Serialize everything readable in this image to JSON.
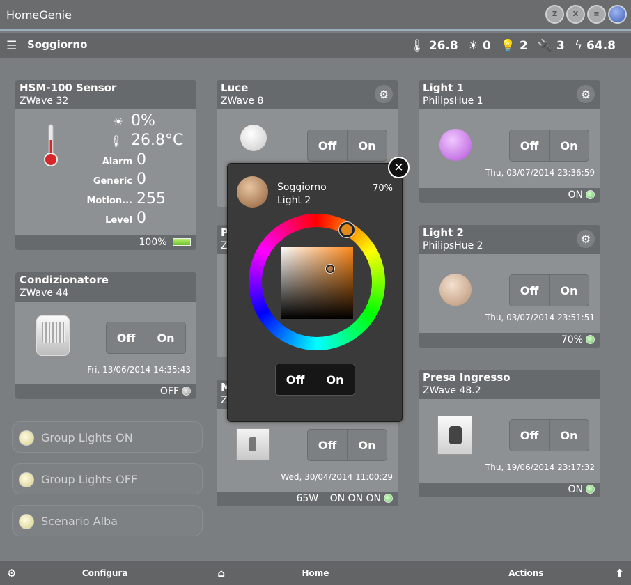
{
  "app": {
    "title": "HomeGenie"
  },
  "header": {
    "room": "Soggiorno",
    "stats": [
      {
        "icon": "thermometer-icon",
        "value": "26.8"
      },
      {
        "icon": "sun-icon",
        "value": "0"
      },
      {
        "icon": "bulb-icon",
        "value": "2"
      },
      {
        "icon": "plug-icon",
        "value": "3"
      },
      {
        "icon": "lightning-icon",
        "value": "64.8"
      }
    ]
  },
  "cards": {
    "hsm": {
      "title": "HSM-100 Sensor",
      "subtitle": "ZWave 32",
      "luminance": "0%",
      "temperature": "26.8°C",
      "rows": [
        {
          "label": "Alarm",
          "value": "0"
        },
        {
          "label": "Generic",
          "value": "0"
        },
        {
          "label": "Motion...",
          "value": "255"
        },
        {
          "label": "Level",
          "value": "0"
        }
      ],
      "battery": "100%"
    },
    "condizionatore": {
      "title": "Condizionatore",
      "subtitle": "ZWave 44",
      "off": "Off",
      "on": "On",
      "timestamp": "Fri, 13/06/2014 14:35:43",
      "status": "OFF"
    },
    "luce": {
      "title": "Luce",
      "subtitle": "ZWave 8",
      "off": "Off",
      "on": "On"
    },
    "partial1": {
      "title": "P",
      "subtitle": "Z"
    },
    "partial2": {
      "title": "M",
      "subtitle": "Z",
      "off": "Off",
      "on": "On",
      "timestamp": "Wed, 30/04/2014 11:00:29",
      "power": "65W",
      "status": "ON ON ON"
    },
    "light1": {
      "title": "Light 1",
      "subtitle": "PhilipsHue 1",
      "off": "Off",
      "on": "On",
      "timestamp": "Thu, 03/07/2014 23:36:59",
      "status": "ON",
      "color": "#c77be6"
    },
    "light2": {
      "title": "Light 2",
      "subtitle": "PhilipsHue 2",
      "off": "Off",
      "on": "On",
      "timestamp": "Thu, 03/07/2014 23:51:51",
      "status": "70%",
      "color": "#c9a98c"
    },
    "presa": {
      "title": "Presa Ingresso",
      "subtitle": "ZWave 48.2",
      "off": "Off",
      "on": "On",
      "timestamp": "Thu, 19/06/2014 23:17:32",
      "status": "ON"
    }
  },
  "scenarios": [
    {
      "label": "Group Lights ON"
    },
    {
      "label": "Group Lights OFF"
    },
    {
      "label": "Scenario Alba"
    }
  ],
  "popup": {
    "room": "Soggiorno",
    "device": "Light 2",
    "level": "70%",
    "off": "Off",
    "on": "On",
    "selected_color": "#e08a1c"
  },
  "footer": {
    "configure": "Configura",
    "home": "Home",
    "actions": "Actions"
  }
}
